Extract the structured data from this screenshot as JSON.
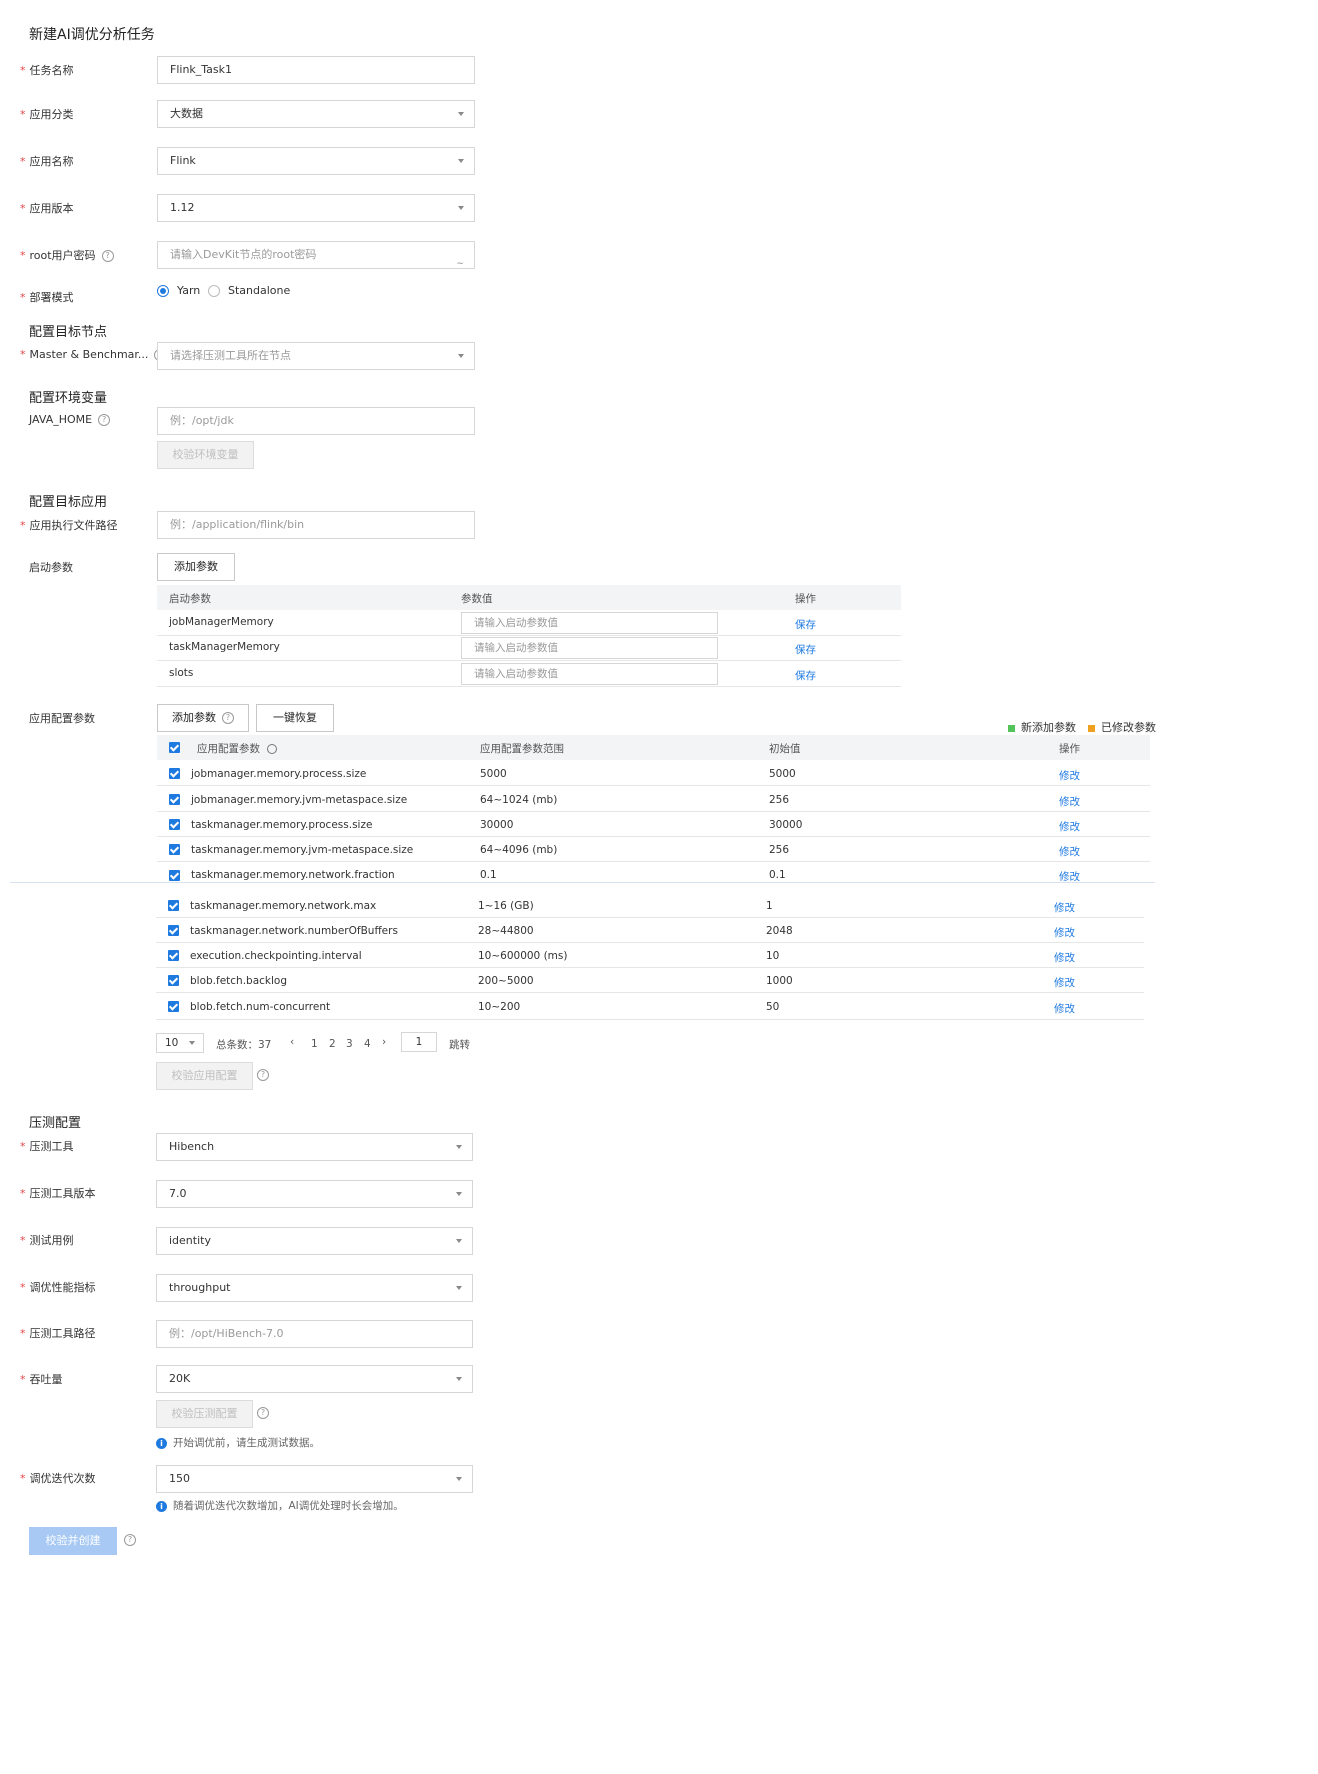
{
  "page_title": "新建AI调优分析任务",
  "fields": {
    "task_name": {
      "label": "任务名称",
      "value": "Flink_Task1"
    },
    "app_category": {
      "label": "应用分类",
      "value": "大数据"
    },
    "app_name": {
      "label": "应用名称",
      "value": "Flink"
    },
    "app_version": {
      "label": "应用版本",
      "value": "1.12"
    },
    "root_password": {
      "label": "root用户密码",
      "placeholder": "请输入DevKit节点的root密码"
    },
    "deploy_mode": {
      "label": "部署模式",
      "options": [
        "Yarn",
        "Standalone"
      ],
      "selected": "Yarn"
    }
  },
  "target_nodes": {
    "section": "配置目标节点",
    "label": "Master & Benchmar...",
    "placeholder": "请选择压测工具所在节点"
  },
  "env": {
    "section": "配置环境变量",
    "label": "JAVA_HOME",
    "placeholder": "例：/opt/jdk",
    "verify_button": "校验环境变量"
  },
  "target_app": {
    "section": "配置目标应用",
    "exec_path_label": "应用执行文件路径",
    "exec_path_placeholder": "例：/application/flink/bin",
    "startup_label": "启动参数",
    "add_param_button": "添加参数",
    "startup_table": {
      "headers": [
        "启动参数",
        "参数值",
        "操作"
      ],
      "rows": [
        {
          "name": "jobManagerMemory",
          "placeholder": "请输入启动参数值",
          "action": "保存"
        },
        {
          "name": "taskManagerMemory",
          "placeholder": "请输入启动参数值",
          "action": "保存"
        },
        {
          "name": "slots",
          "placeholder": "请输入启动参数值",
          "action": "保存"
        }
      ]
    },
    "config_label": "应用配置参数",
    "config_add_button": "添加参数",
    "config_reset_button": "一键恢复",
    "legend": {
      "new": "新添加参数",
      "modified": "已修改参数",
      "new_color": "#52c45a",
      "modified_color": "#f0a020"
    },
    "config_table": {
      "headers": [
        "应用配置参数",
        "应用配置参数范围",
        "初始值",
        "操作"
      ],
      "rows": [
        {
          "name": "jobmanager.memory.process.size",
          "range": "5000",
          "init": "5000",
          "action": "修改"
        },
        {
          "name": "jobmanager.memory.jvm-metaspace.size",
          "range": "64~1024 (mb)",
          "init": "256",
          "action": "修改"
        },
        {
          "name": "taskmanager.memory.process.size",
          "range": "30000",
          "init": "30000",
          "action": "修改"
        },
        {
          "name": "taskmanager.memory.jvm-metaspace.size",
          "range": "64~4096 (mb)",
          "init": "256",
          "action": "修改"
        },
        {
          "name": "taskmanager.memory.network.fraction",
          "range": "0.1",
          "init": "0.1",
          "action": "修改"
        },
        {
          "name": "taskmanager.memory.network.max",
          "range": "1~16 (GB)",
          "init": "1",
          "action": "修改"
        },
        {
          "name": "taskmanager.network.numberOfBuffers",
          "range": "28~44800",
          "init": "2048",
          "action": "修改"
        },
        {
          "name": "execution.checkpointing.interval",
          "range": "10~600000 (ms)",
          "init": "10",
          "action": "修改"
        },
        {
          "name": "blob.fetch.backlog",
          "range": "200~5000",
          "init": "1000",
          "action": "修改"
        },
        {
          "name": "blob.fetch.num-concurrent",
          "range": "10~200",
          "init": "50",
          "action": "修改"
        }
      ]
    },
    "pagination": {
      "page_size": "10",
      "total_label": "总条数：37",
      "pages": [
        "1",
        "2",
        "3",
        "4"
      ],
      "current": "1",
      "jump_value": "1",
      "jump_label": "跳转"
    },
    "verify_config_button": "校验应用配置"
  },
  "benchmark": {
    "section": "压测配置",
    "tool": {
      "label": "压测工具",
      "value": "Hibench"
    },
    "tool_version": {
      "label": "压测工具版本",
      "value": "7.0"
    },
    "test_case": {
      "label": "测试用例",
      "value": "identity"
    },
    "metric": {
      "label": "调优性能指标",
      "value": "throughput"
    },
    "tool_path": {
      "label": "压测工具路径",
      "placeholder": "例：/opt/HiBench-7.0"
    },
    "throughput": {
      "label": "吞吐量",
      "value": "20K"
    },
    "verify_button": "校验压测配置",
    "info_note": "开始调优前，请生成测试数据。",
    "iterations": {
      "label": "调优迭代次数",
      "value": "150"
    },
    "iter_note": "随着调优迭代次数增加，AI调优处理时长会增加。",
    "submit_button": "校验并创建"
  }
}
